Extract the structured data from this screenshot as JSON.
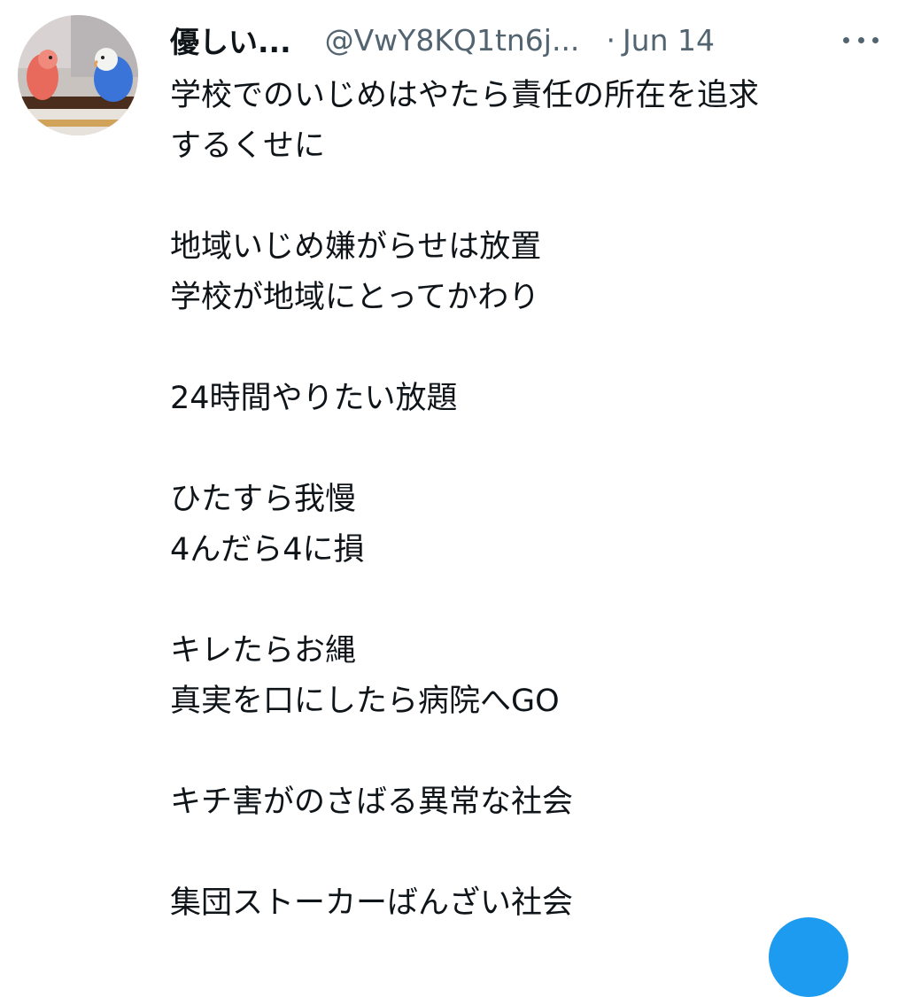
{
  "tweet": {
    "display_name": "優しい...",
    "handle": "@VwY8KQ1tn6j...",
    "separator": "·",
    "date": "Jun 14",
    "more_icon": "more-horizontal-icon",
    "lines": [
      "学校でのいじめはやたら責任の所在を追求",
      "するくせに",
      "",
      "地域いじめ嫌がらせは放置",
      "学校が地域にとってかわり",
      "",
      "24時間やりたい放題",
      "",
      "ひたすら我慢",
      "4んだら4に損",
      "",
      "キレたらお縄",
      "真実を口にしたら病院へGO",
      "",
      "キチ害がのさばる異常な社会",
      "",
      "集団ストーカーばんざい社会"
    ]
  },
  "colors": {
    "text_primary": "#0f1419",
    "text_secondary": "#536471",
    "accent": "#1d9bf0"
  }
}
